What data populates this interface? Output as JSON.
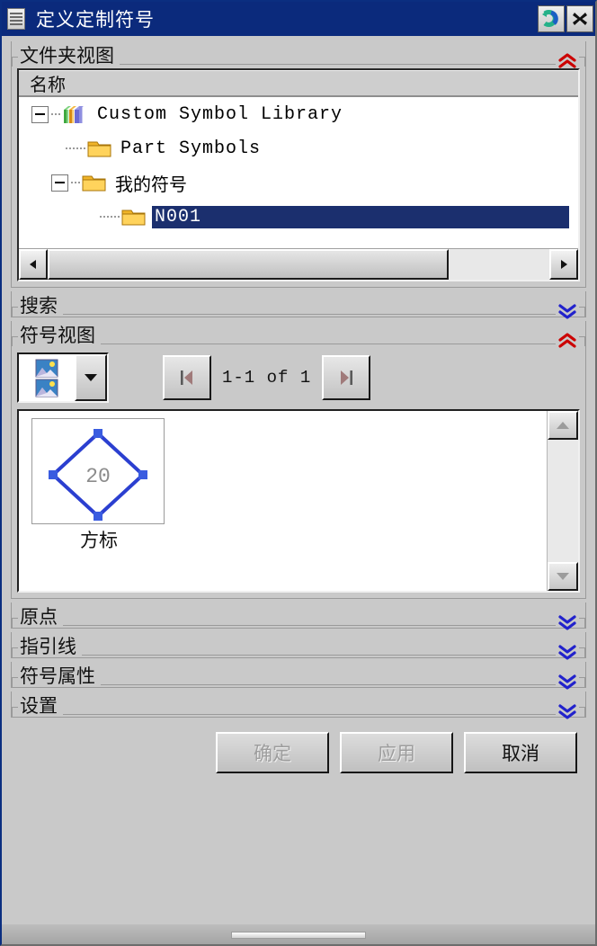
{
  "window": {
    "title": "定义定制符号",
    "menu_icon": "hamburger-menu-icon",
    "reset_button_icon": "reset-arrow-icon",
    "close_button_icon": "close-x-icon",
    "titlebar_color": "#0b2a7c",
    "panel_color": "#c9c9c9"
  },
  "folder_view": {
    "title": "文件夹视图",
    "expanded": true,
    "chevron": "chevron-up-double",
    "chevron_color": "#cc0000",
    "column_header": "名称",
    "tree": [
      {
        "label": "Custom Symbol Library",
        "icon": "books-icon",
        "depth": 0,
        "expander": "minus",
        "selected": false
      },
      {
        "label": "Part Symbols",
        "icon": "folder-icon",
        "depth": 1,
        "expander": "none",
        "selected": false
      },
      {
        "label": "我的符号",
        "icon": "folder-icon",
        "depth": 1,
        "expander": "minus",
        "selected": false
      },
      {
        "label": "N001",
        "icon": "folder-icon",
        "depth": 2,
        "expander": "none",
        "selected": true
      }
    ],
    "selection_color": "#1b2f6e",
    "hscrollbar": {
      "left_arrow": "◀",
      "right_arrow": "▶",
      "thumb_percent": 80
    }
  },
  "search": {
    "title": "搜索",
    "expanded": false,
    "chevron": "chevron-down-double",
    "chevron_color": "#2222cc"
  },
  "symbol_view": {
    "title": "符号视图",
    "expanded": true,
    "chevron": "chevron-up-double",
    "chevron_color": "#cc0000",
    "view_mode_icon": "thumbnail-list-icon",
    "view_mode_dropdown_icon": "chevron-down-icon",
    "pager": {
      "prev_icon": "first-page-icon",
      "next_icon": "last-page-icon",
      "range_label": "1-1 of 1"
    },
    "symbols": [
      {
        "name": "方标",
        "preview": "blue-diamond-symbol",
        "value": "20",
        "shape_color": "#2b3fd0"
      }
    ],
    "vscrollbar": {
      "up_arrow": "▲",
      "down_arrow": "▼"
    }
  },
  "sections": [
    {
      "title": "原点",
      "expanded": false,
      "chevron": "chevron-down-double",
      "chevron_color": "#2222cc"
    },
    {
      "title": "指引线",
      "expanded": false,
      "chevron": "chevron-down-double",
      "chevron_color": "#2222cc"
    },
    {
      "title": "符号属性",
      "expanded": false,
      "chevron": "chevron-down-double",
      "chevron_color": "#2222cc"
    },
    {
      "title": "设置",
      "expanded": false,
      "chevron": "chevron-down-double",
      "chevron_color": "#2222cc"
    }
  ],
  "footer": {
    "ok": "确定",
    "ok_enabled": false,
    "apply": "应用",
    "apply_enabled": false,
    "cancel": "取消",
    "cancel_enabled": true
  }
}
